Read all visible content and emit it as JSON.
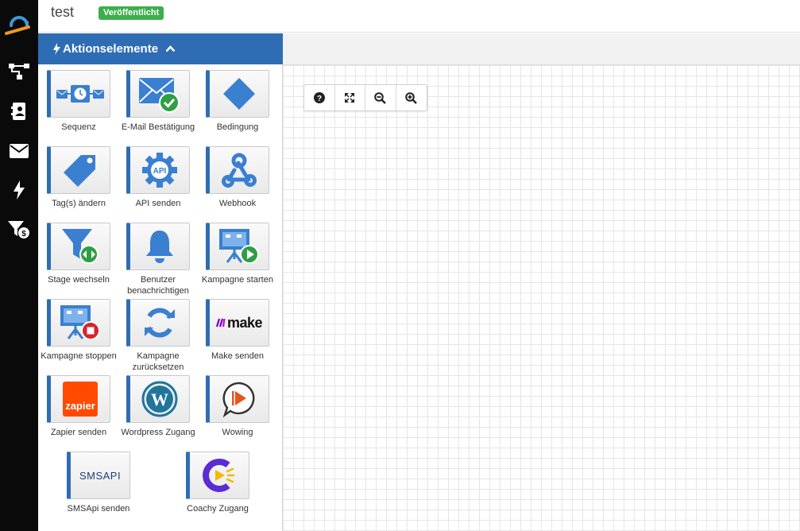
{
  "header": {
    "title": "test",
    "status_badge": "Veröffentlicht"
  },
  "rail": {
    "items": [
      "logo-icon",
      "flow-icon",
      "contacts-icon",
      "mail-icon",
      "bolt-icon",
      "funnel-dollar-icon"
    ]
  },
  "panel": {
    "title": "Aktionselemente",
    "accent_color": "#2e6db4",
    "tiles": [
      {
        "label": "Sequenz",
        "icon": "sequence-icon"
      },
      {
        "label": "E-Mail Bestätigung",
        "icon": "email-confirm-icon"
      },
      {
        "label": "Bedingung",
        "icon": "condition-diamond-icon"
      },
      {
        "label": "Tag(s) ändern",
        "icon": "tag-icon"
      },
      {
        "label": "API senden",
        "icon": "api-gear-icon"
      },
      {
        "label": "Webhook",
        "icon": "webhook-icon"
      },
      {
        "label": "Stage wechseln",
        "icon": "funnel-switch-icon"
      },
      {
        "label": "Benutzer benachrichtigen",
        "icon": "bell-icon"
      },
      {
        "label": "Kampagne starten",
        "icon": "campaign-start-icon"
      },
      {
        "label": "Kampagne stoppen",
        "icon": "campaign-stop-icon"
      },
      {
        "label": "Kampagne zurücksetzen",
        "icon": "reset-icon"
      },
      {
        "label": "Make senden",
        "icon": "make-logo-icon",
        "logo_text": "make"
      },
      {
        "label": "Zapier senden",
        "icon": "zapier-logo-icon",
        "logo_text": "zapier"
      },
      {
        "label": "Wordpress Zugang",
        "icon": "wordpress-logo-icon"
      },
      {
        "label": "Wowing",
        "icon": "wowing-logo-icon"
      },
      {
        "label": "SMSApi senden",
        "icon": "smsapi-logo-icon",
        "logo_text": "SMSAPI"
      },
      {
        "label": "Coachy Zugang",
        "icon": "coachy-logo-icon"
      }
    ]
  },
  "canvas": {
    "toolbar": [
      "help-icon",
      "fit-screen-icon",
      "zoom-out-icon",
      "zoom-in-icon"
    ]
  },
  "colors": {
    "rail_bg": "#0a0a0a",
    "badge_green": "#3cae4a",
    "icon_blue": "#3a7fd0"
  }
}
